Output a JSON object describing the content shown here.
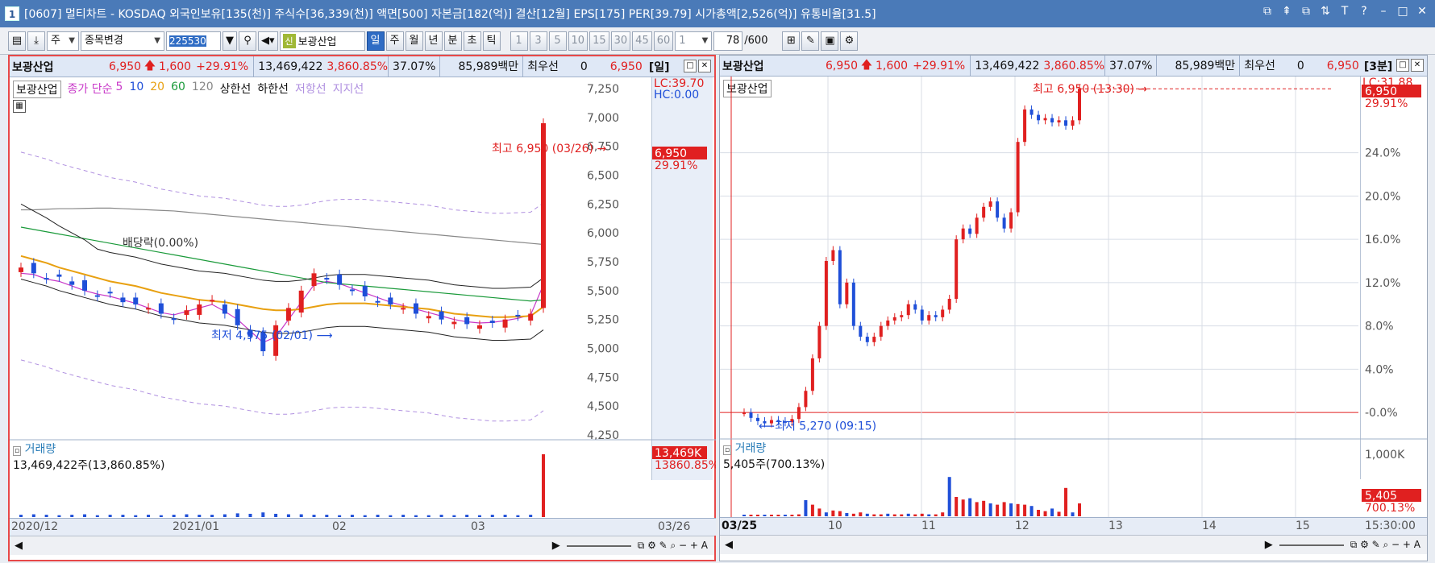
{
  "window": {
    "number": "1",
    "title": "[0607] 멀티차트 - KOSDAQ 외국인보유[135(천)] 주식수[36,339(천)] 액면[500] 자본금[182(억)] 결산[12월] EPS[175] PER[39.79] 시가총액[2,526(억)] 유통비율[31.5]",
    "controls": [
      "⧉",
      "⇞",
      "⧉",
      "⇅",
      "T",
      "?",
      "–",
      "□",
      "✕"
    ]
  },
  "toolbar": {
    "type_combo": "주",
    "change_combo": "종목변경",
    "code_value": "225530",
    "stock_badge": "신",
    "stock_name": "보광산업",
    "periods": [
      "일",
      "주",
      "월",
      "년",
      "분",
      "초",
      "틱"
    ],
    "active_period": "일",
    "intervals": [
      "1",
      "3",
      "5",
      "10",
      "15",
      "30",
      "45",
      "60"
    ],
    "interval_value": "1",
    "count_value": "78",
    "count_total": "/600"
  },
  "left_pane": {
    "header": {
      "name": "보광산업",
      "price": "6,950",
      "change": "1,600",
      "change_pct": "+29.91%",
      "volume": "13,469,422",
      "vol_pct": "3,860.85%",
      "turnover": "37.07%",
      "amount": "85,989백만",
      "bid_label": "최우선",
      "bid_qty": "0",
      "bid_price": "6,950",
      "period_tag": "[일]"
    },
    "legend": {
      "stock": "보광산업",
      "ma_label": "종가 단순",
      "ma5": "5",
      "ma10": "10",
      "ma20": "20",
      "ma60": "60",
      "ma120": "120",
      "upper": "상한선",
      "lower": "하한선",
      "resist": "저항선",
      "support": "지지선"
    },
    "scale_top": {
      "lc": "LC:39.70",
      "hc": "HC:0.00"
    },
    "price_ticks": [
      "7,250",
      "7,000",
      "6,750",
      "6,500",
      "6,250",
      "6,000",
      "5,750",
      "5,500",
      "5,250",
      "5,000",
      "4,750",
      "4,500",
      "4,250"
    ],
    "current_label": "6,950",
    "current_pct": "29.91%",
    "annotations": {
      "high": "최고 6,950 (03/26)",
      "low": "최저 4,975 (02/01)",
      "dividend": "배당락(0.00%)"
    },
    "volume": {
      "title": "거래량",
      "value": "13,469,422주(13,860.85%)",
      "scale_label": "13,469K",
      "scale_pct": "13860.85%"
    },
    "dates": [
      "2020/12",
      "2021/01",
      "02",
      "03"
    ],
    "last_date": "03/26"
  },
  "right_pane": {
    "header": {
      "name": "보광산업",
      "price": "6,950",
      "change": "1,600",
      "change_pct": "+29.91%",
      "volume": "13,469,422",
      "vol_pct": "3,860.85%",
      "turnover": "37.07%",
      "amount": "85,989백만",
      "bid_label": "최우선",
      "bid_qty": "0",
      "bid_price": "6,950",
      "period_tag": "[3분]"
    },
    "legend": {
      "stock": "보광산업"
    },
    "scale_top": {
      "lc": "LC:31.88"
    },
    "pct_ticks": [
      "24.0%",
      "20.0%",
      "16.0%",
      "12.0%",
      "8.0%",
      "4.0%",
      "-0.0%"
    ],
    "current_label": "6,950",
    "current_pct": "29.91%",
    "annotations": {
      "high": "최고 6,950 (13:30)",
      "low": "최저 5,270 (09:15)"
    },
    "volume": {
      "title": "거래량",
      "value": "5,405주(700.13%)",
      "scale_top": "1,000K",
      "scale_label": "5,405",
      "scale_pct": "700.13%"
    },
    "dates": [
      "03/25",
      "10",
      "11",
      "12",
      "13",
      "14",
      "15"
    ],
    "last_time": "15:30:00"
  },
  "colors": {
    "up": "#e02020",
    "down": "#1f4fd8",
    "accent": "#2f6cc4"
  },
  "chart_data": [
    {
      "type": "candlestick",
      "title": "보광산업 [일]",
      "x": [
        "2020/12",
        "2021/01",
        "02",
        "03",
        "03/26"
      ],
      "ylim": [
        4250,
        7250
      ],
      "series": [
        {
          "name": "보광산업",
          "values": [
            5700,
            5650,
            5600,
            5620,
            5550,
            5500,
            5450,
            5480,
            5400,
            5380,
            5350,
            5300,
            5250,
            5330,
            5380,
            5420,
            5300,
            5200,
            5100,
            4975,
            5200,
            5350,
            5500,
            5650,
            5600,
            5550,
            5500,
            5450,
            5400,
            5380,
            5350,
            5300,
            5280,
            5250,
            5230,
            5210,
            5200,
            5220,
            5250,
            5280,
            5300,
            6950
          ]
        },
        {
          "name": "5",
          "values": [
            5650,
            5640,
            5600,
            5580,
            5540,
            5500,
            5470,
            5450,
            5420,
            5390,
            5350,
            5310,
            5290,
            5320,
            5350,
            5380,
            5320,
            5250,
            5150,
            5050,
            5100,
            5250,
            5400,
            5550,
            5580,
            5560,
            5520,
            5480,
            5440,
            5400,
            5370,
            5340,
            5310,
            5280,
            5250,
            5230,
            5220,
            5225,
            5240,
            5260,
            5290,
            5550
          ]
        },
        {
          "name": "20",
          "values": [
            5800,
            5770,
            5740,
            5700,
            5670,
            5640,
            5610,
            5580,
            5560,
            5540,
            5510,
            5480,
            5460,
            5440,
            5420,
            5410,
            5400,
            5380,
            5360,
            5340,
            5330,
            5330,
            5340,
            5360,
            5380,
            5390,
            5390,
            5390,
            5380,
            5370,
            5360,
            5350,
            5340,
            5320,
            5300,
            5290,
            5280,
            5270,
            5270,
            5275,
            5280,
            5360
          ]
        },
        {
          "name": "60",
          "values": [
            6050,
            6030,
            6010,
            5990,
            5970,
            5950,
            5930,
            5910,
            5890,
            5870,
            5850,
            5830,
            5810,
            5790,
            5770,
            5750,
            5730,
            5710,
            5690,
            5670,
            5650,
            5630,
            5610,
            5590,
            5570,
            5560,
            5550,
            5540,
            5530,
            5520,
            5510,
            5500,
            5490,
            5480,
            5470,
            5460,
            5450,
            5440,
            5430,
            5420,
            5410,
            5420
          ]
        },
        {
          "name": "120",
          "values": [
            6200,
            6200,
            6205,
            6210,
            6210,
            6212,
            6215,
            6215,
            6210,
            6205,
            6200,
            6195,
            6190,
            6180,
            6170,
            6160,
            6150,
            6140,
            6130,
            6120,
            6110,
            6100,
            6090,
            6080,
            6070,
            6060,
            6050,
            6040,
            6030,
            6020,
            6010,
            6000,
            5990,
            5980,
            5970,
            5960,
            5950,
            5940,
            5930,
            5920,
            5910,
            5900
          ]
        }
      ],
      "volume": [
        0.5,
        0.6,
        0.5,
        0.4,
        0.5,
        0.6,
        0.4,
        0.5,
        0.5,
        0.4,
        0.5,
        0.4,
        0.5,
        0.6,
        0.5,
        0.5,
        0.6,
        0.8,
        0.7,
        1.0,
        0.7,
        0.6,
        0.6,
        0.5,
        0.5,
        0.4,
        0.5,
        0.4,
        0.5,
        0.4,
        0.5,
        0.4,
        0.4,
        0.5,
        0.4,
        0.5,
        0.4,
        0.5,
        0.5,
        0.4,
        0.5,
        13.469
      ]
    },
    {
      "type": "candlestick",
      "title": "보광산업 [3분]",
      "x": [
        "03/25",
        "10",
        "11",
        "12",
        "13",
        "14",
        "15"
      ],
      "y_unit": "%",
      "ylim": [
        -0.0,
        28.0
      ],
      "series": [
        {
          "name": "보광산업",
          "values": [
            0,
            -0.5,
            -0.8,
            -1.0,
            -0.7,
            -0.8,
            -0.9,
            -0.6,
            0.5,
            2,
            5,
            8,
            14,
            15,
            10,
            12,
            8,
            7,
            6.5,
            7,
            8,
            8.5,
            8.8,
            9,
            10,
            9.5,
            8.5,
            9,
            8.8,
            9.5,
            10.5,
            16,
            17,
            16.5,
            18,
            19,
            19.5,
            18,
            17,
            18.5,
            25,
            28,
            27.5,
            27,
            27.2,
            26.8,
            27,
            26.5,
            27,
            29.91
          ]
        }
      ],
      "volume_k": [
        2,
        1,
        1,
        2,
        1,
        3,
        2,
        1,
        30,
        250,
        180,
        120,
        60,
        90,
        80,
        50,
        40,
        60,
        40,
        30,
        30,
        40,
        30,
        30,
        40,
        30,
        40,
        30,
        30,
        60,
        610,
        300,
        260,
        280,
        220,
        240,
        200,
        180,
        220,
        200,
        190,
        180,
        160,
        100,
        80,
        120,
        70,
        440,
        60,
        200
      ]
    }
  ]
}
